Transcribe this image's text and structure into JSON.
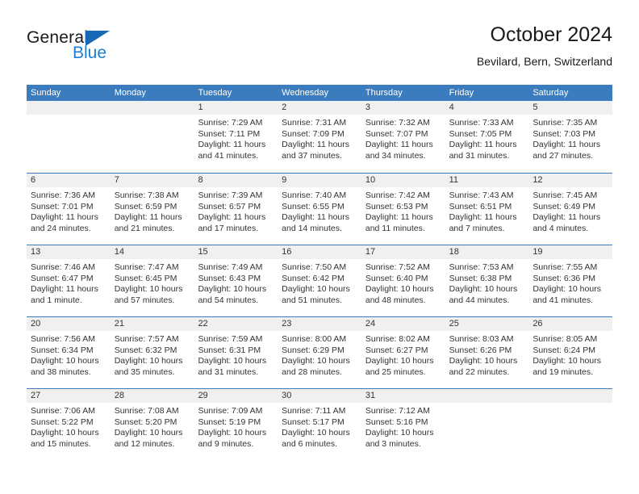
{
  "brand": {
    "name_part1": "General",
    "name_part2": "Blue",
    "triangle_color": "#1769b5",
    "blue_color": "#1a7fd4"
  },
  "header": {
    "title": "October 2024",
    "subtitle": "Bevilard, Bern, Switzerland"
  },
  "theme": {
    "header_bar_color": "#3a7cbe",
    "day_band_color": "#f0f0f0",
    "text_color": "#333333"
  },
  "weekdays": [
    "Sunday",
    "Monday",
    "Tuesday",
    "Wednesday",
    "Thursday",
    "Friday",
    "Saturday"
  ],
  "weeks": [
    [
      {
        "day": "",
        "empty": true
      },
      {
        "day": "",
        "empty": true
      },
      {
        "day": "1",
        "sunrise": "Sunrise: 7:29 AM",
        "sunset": "Sunset: 7:11 PM",
        "daylight1": "Daylight: 11 hours",
        "daylight2": "and 41 minutes."
      },
      {
        "day": "2",
        "sunrise": "Sunrise: 7:31 AM",
        "sunset": "Sunset: 7:09 PM",
        "daylight1": "Daylight: 11 hours",
        "daylight2": "and 37 minutes."
      },
      {
        "day": "3",
        "sunrise": "Sunrise: 7:32 AM",
        "sunset": "Sunset: 7:07 PM",
        "daylight1": "Daylight: 11 hours",
        "daylight2": "and 34 minutes."
      },
      {
        "day": "4",
        "sunrise": "Sunrise: 7:33 AM",
        "sunset": "Sunset: 7:05 PM",
        "daylight1": "Daylight: 11 hours",
        "daylight2": "and 31 minutes."
      },
      {
        "day": "5",
        "sunrise": "Sunrise: 7:35 AM",
        "sunset": "Sunset: 7:03 PM",
        "daylight1": "Daylight: 11 hours",
        "daylight2": "and 27 minutes."
      }
    ],
    [
      {
        "day": "6",
        "sunrise": "Sunrise: 7:36 AM",
        "sunset": "Sunset: 7:01 PM",
        "daylight1": "Daylight: 11 hours",
        "daylight2": "and 24 minutes."
      },
      {
        "day": "7",
        "sunrise": "Sunrise: 7:38 AM",
        "sunset": "Sunset: 6:59 PM",
        "daylight1": "Daylight: 11 hours",
        "daylight2": "and 21 minutes."
      },
      {
        "day": "8",
        "sunrise": "Sunrise: 7:39 AM",
        "sunset": "Sunset: 6:57 PM",
        "daylight1": "Daylight: 11 hours",
        "daylight2": "and 17 minutes."
      },
      {
        "day": "9",
        "sunrise": "Sunrise: 7:40 AM",
        "sunset": "Sunset: 6:55 PM",
        "daylight1": "Daylight: 11 hours",
        "daylight2": "and 14 minutes."
      },
      {
        "day": "10",
        "sunrise": "Sunrise: 7:42 AM",
        "sunset": "Sunset: 6:53 PM",
        "daylight1": "Daylight: 11 hours",
        "daylight2": "and 11 minutes."
      },
      {
        "day": "11",
        "sunrise": "Sunrise: 7:43 AM",
        "sunset": "Sunset: 6:51 PM",
        "daylight1": "Daylight: 11 hours",
        "daylight2": "and 7 minutes."
      },
      {
        "day": "12",
        "sunrise": "Sunrise: 7:45 AM",
        "sunset": "Sunset: 6:49 PM",
        "daylight1": "Daylight: 11 hours",
        "daylight2": "and 4 minutes."
      }
    ],
    [
      {
        "day": "13",
        "sunrise": "Sunrise: 7:46 AM",
        "sunset": "Sunset: 6:47 PM",
        "daylight1": "Daylight: 11 hours",
        "daylight2": "and 1 minute."
      },
      {
        "day": "14",
        "sunrise": "Sunrise: 7:47 AM",
        "sunset": "Sunset: 6:45 PM",
        "daylight1": "Daylight: 10 hours",
        "daylight2": "and 57 minutes."
      },
      {
        "day": "15",
        "sunrise": "Sunrise: 7:49 AM",
        "sunset": "Sunset: 6:43 PM",
        "daylight1": "Daylight: 10 hours",
        "daylight2": "and 54 minutes."
      },
      {
        "day": "16",
        "sunrise": "Sunrise: 7:50 AM",
        "sunset": "Sunset: 6:42 PM",
        "daylight1": "Daylight: 10 hours",
        "daylight2": "and 51 minutes."
      },
      {
        "day": "17",
        "sunrise": "Sunrise: 7:52 AM",
        "sunset": "Sunset: 6:40 PM",
        "daylight1": "Daylight: 10 hours",
        "daylight2": "and 48 minutes."
      },
      {
        "day": "18",
        "sunrise": "Sunrise: 7:53 AM",
        "sunset": "Sunset: 6:38 PM",
        "daylight1": "Daylight: 10 hours",
        "daylight2": "and 44 minutes."
      },
      {
        "day": "19",
        "sunrise": "Sunrise: 7:55 AM",
        "sunset": "Sunset: 6:36 PM",
        "daylight1": "Daylight: 10 hours",
        "daylight2": "and 41 minutes."
      }
    ],
    [
      {
        "day": "20",
        "sunrise": "Sunrise: 7:56 AM",
        "sunset": "Sunset: 6:34 PM",
        "daylight1": "Daylight: 10 hours",
        "daylight2": "and 38 minutes."
      },
      {
        "day": "21",
        "sunrise": "Sunrise: 7:57 AM",
        "sunset": "Sunset: 6:32 PM",
        "daylight1": "Daylight: 10 hours",
        "daylight2": "and 35 minutes."
      },
      {
        "day": "22",
        "sunrise": "Sunrise: 7:59 AM",
        "sunset": "Sunset: 6:31 PM",
        "daylight1": "Daylight: 10 hours",
        "daylight2": "and 31 minutes."
      },
      {
        "day": "23",
        "sunrise": "Sunrise: 8:00 AM",
        "sunset": "Sunset: 6:29 PM",
        "daylight1": "Daylight: 10 hours",
        "daylight2": "and 28 minutes."
      },
      {
        "day": "24",
        "sunrise": "Sunrise: 8:02 AM",
        "sunset": "Sunset: 6:27 PM",
        "daylight1": "Daylight: 10 hours",
        "daylight2": "and 25 minutes."
      },
      {
        "day": "25",
        "sunrise": "Sunrise: 8:03 AM",
        "sunset": "Sunset: 6:26 PM",
        "daylight1": "Daylight: 10 hours",
        "daylight2": "and 22 minutes."
      },
      {
        "day": "26",
        "sunrise": "Sunrise: 8:05 AM",
        "sunset": "Sunset: 6:24 PM",
        "daylight1": "Daylight: 10 hours",
        "daylight2": "and 19 minutes."
      }
    ],
    [
      {
        "day": "27",
        "sunrise": "Sunrise: 7:06 AM",
        "sunset": "Sunset: 5:22 PM",
        "daylight1": "Daylight: 10 hours",
        "daylight2": "and 15 minutes."
      },
      {
        "day": "28",
        "sunrise": "Sunrise: 7:08 AM",
        "sunset": "Sunset: 5:20 PM",
        "daylight1": "Daylight: 10 hours",
        "daylight2": "and 12 minutes."
      },
      {
        "day": "29",
        "sunrise": "Sunrise: 7:09 AM",
        "sunset": "Sunset: 5:19 PM",
        "daylight1": "Daylight: 10 hours",
        "daylight2": "and 9 minutes."
      },
      {
        "day": "30",
        "sunrise": "Sunrise: 7:11 AM",
        "sunset": "Sunset: 5:17 PM",
        "daylight1": "Daylight: 10 hours",
        "daylight2": "and 6 minutes."
      },
      {
        "day": "31",
        "sunrise": "Sunrise: 7:12 AM",
        "sunset": "Sunset: 5:16 PM",
        "daylight1": "Daylight: 10 hours",
        "daylight2": "and 3 minutes."
      },
      {
        "day": "",
        "empty": true
      },
      {
        "day": "",
        "empty": true
      }
    ]
  ]
}
